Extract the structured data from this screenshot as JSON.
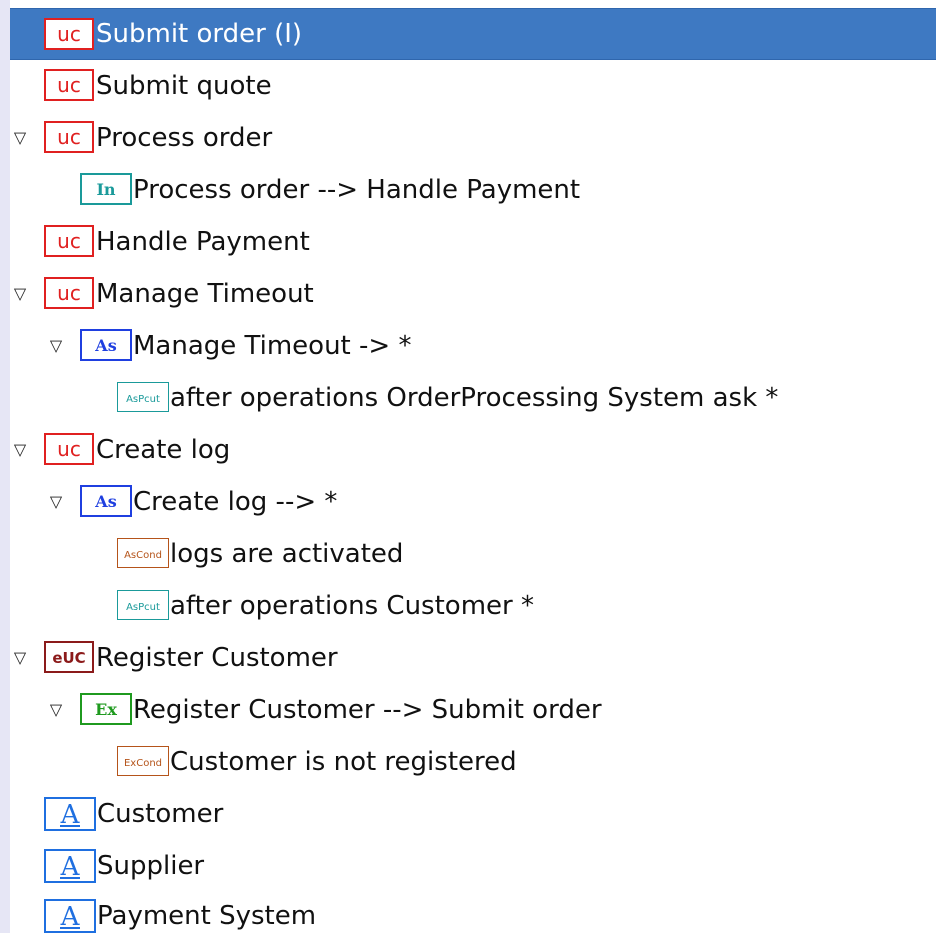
{
  "tree": {
    "items": [
      {
        "label": "Submit order (I)",
        "icon": "use-case-icon",
        "icon_text": "uc",
        "selected": true,
        "expandable": false
      },
      {
        "label": "Submit quote",
        "icon": "use-case-icon",
        "icon_text": "uc",
        "expandable": false
      },
      {
        "label": "Process order",
        "icon": "use-case-icon",
        "icon_text": "uc",
        "expandable": true,
        "expanded": true
      },
      {
        "label": "Process order --> Handle Payment",
        "icon": "include-relation-icon",
        "icon_text": "In",
        "expandable": false
      },
      {
        "label": "Handle Payment",
        "icon": "use-case-icon",
        "icon_text": "uc",
        "expandable": false
      },
      {
        "label": "Manage Timeout",
        "icon": "use-case-icon",
        "icon_text": "uc",
        "expandable": true,
        "expanded": true
      },
      {
        "label": "Manage Timeout -> *",
        "icon": "aspect-relation-icon",
        "icon_text": "As",
        "expandable": true,
        "expanded": true
      },
      {
        "label": "after operations OrderProcessing System ask *",
        "icon": "aspect-pointcut-icon",
        "icon_text": "AsPcut",
        "expandable": false
      },
      {
        "label": "Create log",
        "icon": "use-case-icon",
        "icon_text": "uc",
        "expandable": true,
        "expanded": true
      },
      {
        "label": "Create log --> *",
        "icon": "aspect-relation-icon",
        "icon_text": "As",
        "expandable": true,
        "expanded": true
      },
      {
        "label": "logs are activated",
        "icon": "aspect-condition-icon",
        "icon_text": "AsCond",
        "expandable": false
      },
      {
        "label": "after operations Customer *",
        "icon": "aspect-pointcut-icon",
        "icon_text": "AsPcut",
        "expandable": false
      },
      {
        "label": "Register Customer",
        "icon": "extended-use-case-icon",
        "icon_text": "eUC",
        "expandable": true,
        "expanded": true
      },
      {
        "label": "Register Customer --> Submit order",
        "icon": "extend-relation-icon",
        "icon_text": "Ex",
        "expandable": true,
        "expanded": true
      },
      {
        "label": "Customer is not registered",
        "icon": "extend-condition-icon",
        "icon_text": "ExCond",
        "expandable": false
      },
      {
        "label": "Customer",
        "icon": "actor-icon",
        "icon_text": "A",
        "expandable": false
      },
      {
        "label": "Supplier",
        "icon": "actor-icon",
        "icon_text": "A",
        "expandable": false
      },
      {
        "label": "Payment System",
        "icon": "actor-icon",
        "icon_text": "A",
        "expandable": false
      }
    ]
  },
  "colors": {
    "selection": "#3e79c2",
    "use_case": "#e02020",
    "include": "#1a9a9a",
    "aspect": "#1f3fe0",
    "aspect_pointcut": "#1a9a9a",
    "aspect_condition": "#b5541a",
    "extended_use_case": "#8b1a1a",
    "extend": "#1f9a1f",
    "actor": "#1f6fe0"
  }
}
